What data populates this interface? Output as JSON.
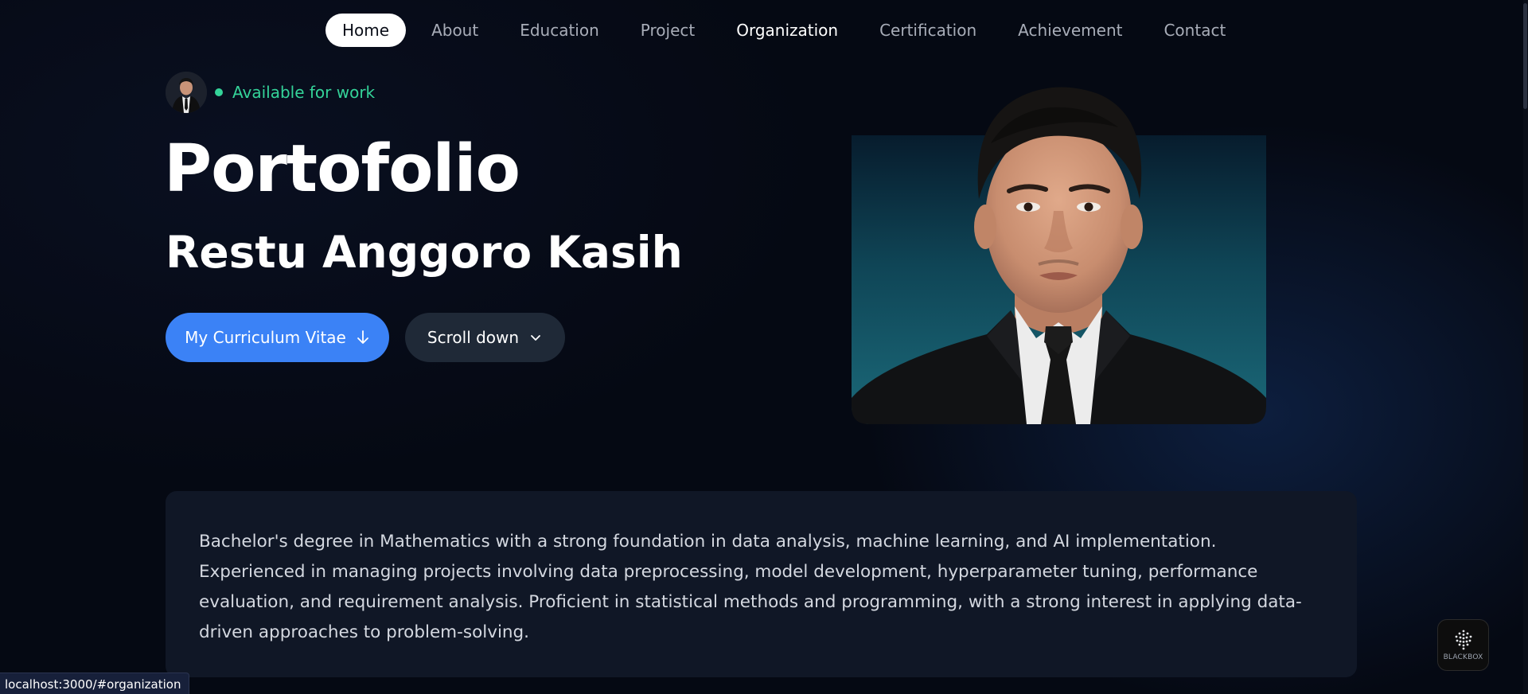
{
  "nav": {
    "items": [
      {
        "label": "Home",
        "active": true
      },
      {
        "label": "About"
      },
      {
        "label": "Education"
      },
      {
        "label": "Project"
      },
      {
        "label": "Organization",
        "hovered": true
      },
      {
        "label": "Certification"
      },
      {
        "label": "Achievement"
      },
      {
        "label": "Contact"
      }
    ]
  },
  "hero": {
    "availability": "Available for work",
    "title": "Portofolio",
    "name": "Restu Anggoro Kasih",
    "cv_button": "My Curriculum Vitae",
    "scroll_button": "Scroll down"
  },
  "about": {
    "text": "Bachelor's degree in Mathematics with a strong foundation in data analysis, machine learning, and AI implementation. Experienced in managing projects involving data preprocessing, model development, hyperparameter tuning, performance evaluation, and requirement analysis. Proficient in statistical methods and programming, with a strong interest in applying data-driven approaches to problem-solving."
  },
  "status_bar": {
    "url": "localhost:3000/#organization"
  },
  "widget": {
    "label": "BLACKBOX"
  },
  "colors": {
    "accent": "#3b82f6",
    "available": "#34d399",
    "background": "#050913",
    "card": "#101726"
  },
  "icons": {
    "cv": "arrow-down-icon",
    "scroll": "chevron-down-icon",
    "status": "status-dot-icon"
  }
}
